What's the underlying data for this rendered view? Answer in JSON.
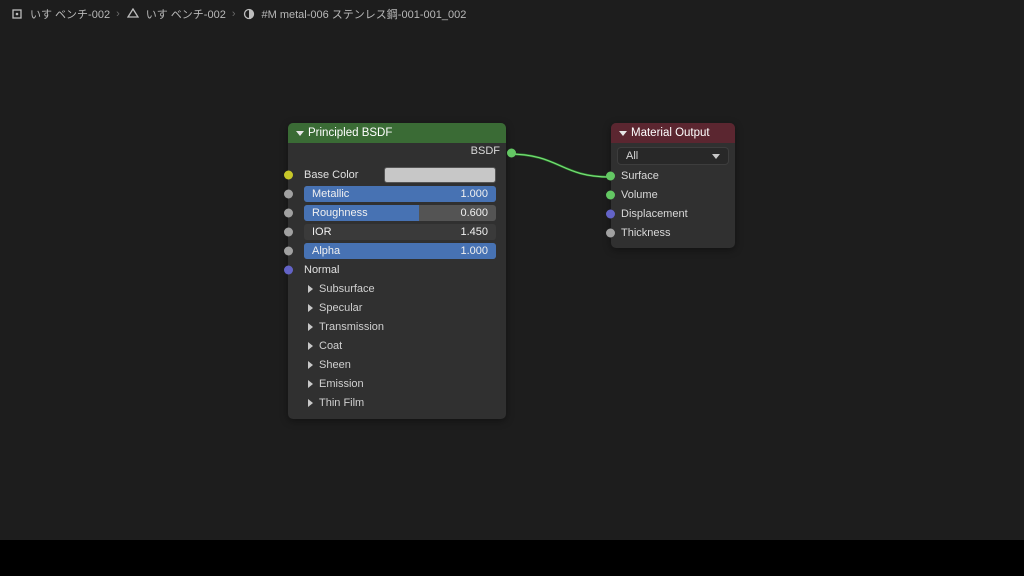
{
  "breadcrumb": {
    "item1": "いす ベンチ-002",
    "item2": "いす ベンチ-002",
    "item3": "#M metal-006 ステンレス鋼-001-001_002"
  },
  "principled": {
    "title": "Principled BSDF",
    "out_bsdf": "BSDF",
    "base_color_label": "Base Color",
    "base_color_hex": "#c7c7c7",
    "metallic_label": "Metallic",
    "metallic_value": "1.000",
    "roughness_label": "Roughness",
    "roughness_value": "0.600",
    "ior_label": "IOR",
    "ior_value": "1.450",
    "alpha_label": "Alpha",
    "alpha_value": "1.000",
    "normal_label": "Normal",
    "groups": {
      "subsurface": "Subsurface",
      "specular": "Specular",
      "transmission": "Transmission",
      "coat": "Coat",
      "sheen": "Sheen",
      "emission": "Emission",
      "thin_film": "Thin Film"
    }
  },
  "output": {
    "title": "Material Output",
    "target_label": "All",
    "surface": "Surface",
    "volume": "Volume",
    "displacement": "Displacement",
    "thickness": "Thickness"
  }
}
